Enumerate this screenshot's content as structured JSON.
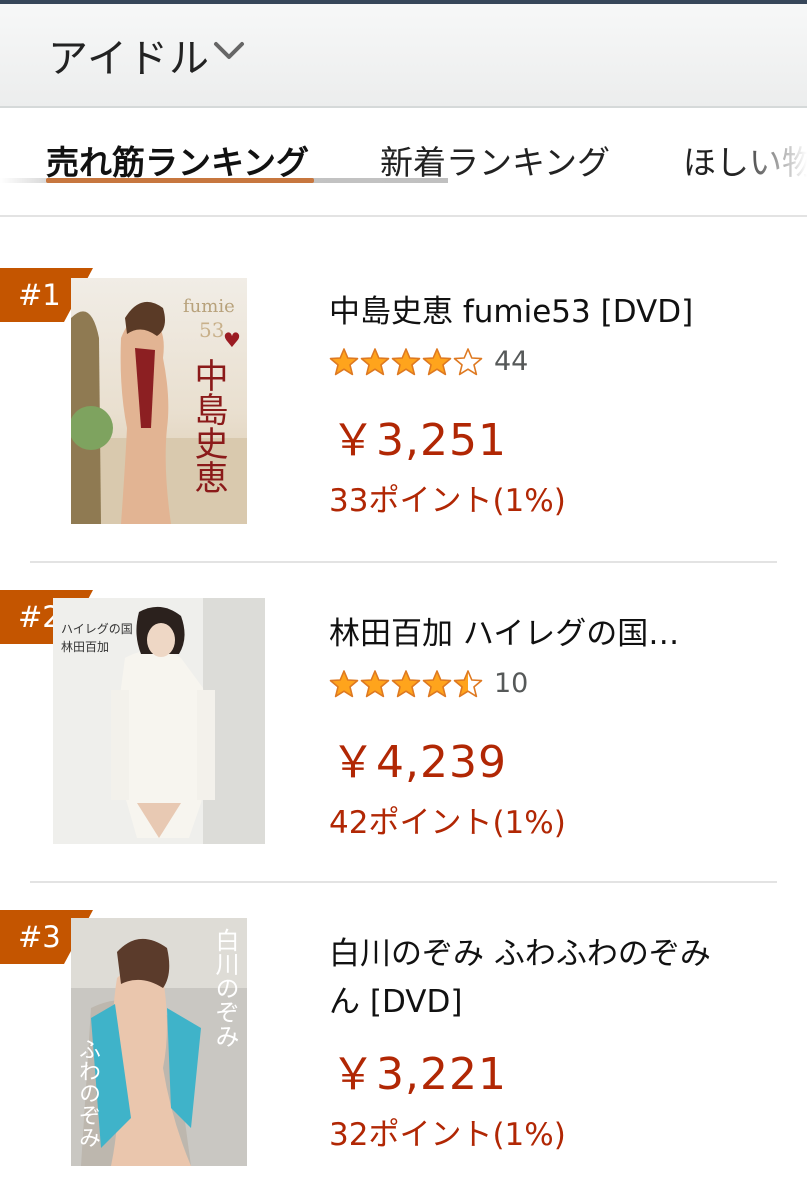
{
  "header": {
    "category": "アイドル",
    "chevron_icon": "chevron-down-icon"
  },
  "tabs": [
    {
      "label": "売れ筋ランキング",
      "active": true
    },
    {
      "label": "新着ランキング",
      "active": false
    },
    {
      "label": "ほしい物",
      "active": false
    }
  ],
  "items": [
    {
      "rank": "#1",
      "title": "中島史恵 fumie53 [DVD]",
      "rating": 4,
      "rating_count": "44",
      "price": "￥3,251",
      "points": "33ポイント(1%)",
      "cover_text": "fumie",
      "cover_number": "53",
      "cover_name": "中島史恵"
    },
    {
      "rank": "#2",
      "title": "林田百加 ハイレグの国…",
      "rating": 4.5,
      "rating_count": "10",
      "price": "￥4,239",
      "points": "42ポイント(1%)",
      "cover_text_1": "ハイレグの国",
      "cover_text_2": "林田百加"
    },
    {
      "rank": "#3",
      "title": "白川のぞみ ふわふわのぞみ ん [DVD]",
      "title_line1": "白川のぞみ ふわふわのぞみ",
      "title_line2": "ん [DVD]",
      "price": "￥3,221",
      "points": "32ポイント(1%)",
      "cover_name": "白川のぞみ",
      "cover_sub": "ふわのぞみ"
    }
  ],
  "colors": {
    "price": "#b12704",
    "badge": "#c45500",
    "star": "#ffa41c",
    "tab_underline": "#c7773f"
  }
}
